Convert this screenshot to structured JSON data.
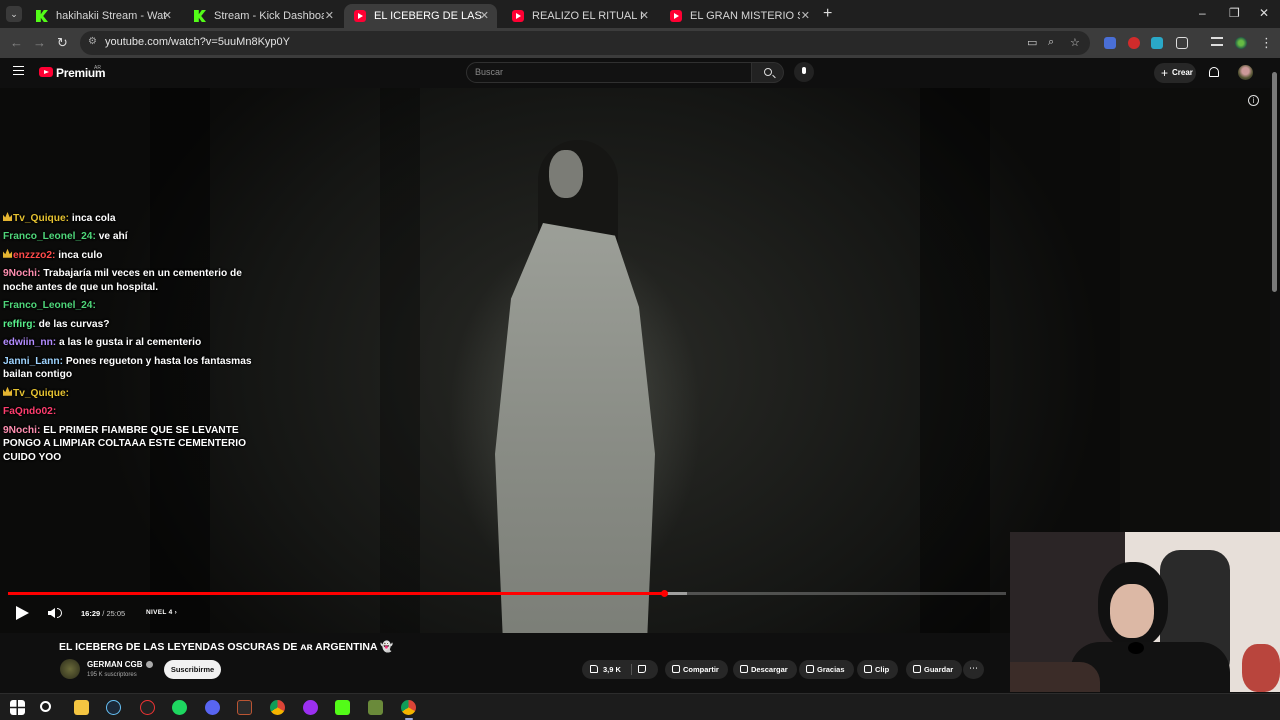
{
  "browser": {
    "tabs": [
      {
        "title": "hakihakii Stream - Watch Live on",
        "favicon": "kick-icon",
        "active": false
      },
      {
        "title": "Stream - Kick Dashboard",
        "favicon": "kick-icon",
        "active": false
      },
      {
        "title": "EL ICEBERG DE LAS LEYENDAS O",
        "favicon": "youtube-icon",
        "active": true
      },
      {
        "title": "REALIZO EL RITUAL DE HITORI",
        "favicon": "youtube-icon",
        "active": false
      },
      {
        "title": "EL GRAN MISTERIO SIN RESOLV",
        "favicon": "youtube-icon",
        "active": false
      }
    ],
    "url": "youtube.com/watch?v=5uuMn8Kyp0Y"
  },
  "youtube": {
    "brand": "Premium",
    "region": "AR",
    "search_placeholder": "Buscar",
    "create_label": "Crear"
  },
  "chat": [
    {
      "name": "Tv_Quique:",
      "name_color": "#e5c231",
      "badge": true,
      "text": "inca cola"
    },
    {
      "name": "Franco_Leonel_24:",
      "name_color": "#4fd67a",
      "badge": false,
      "text": "ve ahí"
    },
    {
      "name": "enzzzo2:",
      "name_color": "#ff4b4b",
      "badge": true,
      "text": "inca culo"
    },
    {
      "name": "9Nochi:",
      "name_color": "#ff8fb1",
      "badge": false,
      "text": "Trabajaría mil veces en un cementerio de noche antes de que un hospital."
    },
    {
      "name": "Franco_Leonel_24:",
      "name_color": "#4fd67a",
      "badge": false,
      "text": ""
    },
    {
      "name": "reffirg:",
      "name_color": "#59f08c",
      "badge": false,
      "text": "de las curvas?"
    },
    {
      "name": "edwiin_nn:",
      "name_color": "#b38cff",
      "badge": false,
      "text": "a las  le gusta ir al cementerio"
    },
    {
      "name": "Janni_Lann:",
      "name_color": "#9fd4ff",
      "badge": false,
      "text": "Pones regueton y hasta los fantasmas bailan contigo"
    },
    {
      "name": "Tv_Quique:",
      "name_color": "#e5c231",
      "badge": true,
      "text": ""
    },
    {
      "name": "FaQndo02:",
      "name_color": "#ff3d6e",
      "badge": false,
      "text": ""
    },
    {
      "name": "9Nochi:",
      "name_color": "#ff8fb1",
      "badge": false,
      "text": "EL PRIMER FIAMBRE QUE SE LEVANTE PONGO A LIMPIAR COLTAAA ESTE CEMENTERIO CUIDO YOO"
    }
  ],
  "player": {
    "current_time": "16:29",
    "duration": "25:05",
    "chapter": "NIVEL 4",
    "progress_fraction": 0.657,
    "buffered_fraction": 0.68
  },
  "video": {
    "title": "EL ICEBERG DE LAS LEYENDAS OSCURAS DE ᴀʀ ARGENTINA",
    "channel": "GERMAN CGB",
    "subscribers": "195 K suscriptores",
    "subscribe_label": "Suscribirme",
    "likes": "3,9 K",
    "actions": [
      "Compartir",
      "Descargar",
      "Gracias",
      "Clip",
      "Guardar"
    ]
  },
  "colors": {
    "accent": "#ff0000",
    "youtube_red": "#ff0033",
    "kick_green": "#53fc18"
  }
}
